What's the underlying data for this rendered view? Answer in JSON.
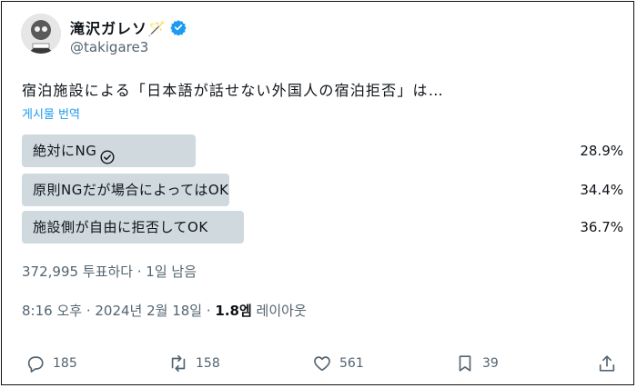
{
  "author": {
    "display_name": "滝沢ガレソ🪄",
    "handle": "@takigare3",
    "verified": true
  },
  "tweet": {
    "text": "宿泊施設による「日本語が話せない外国人の宿泊拒否」は…",
    "translate_label": "게시물 번역"
  },
  "poll": {
    "options": [
      {
        "label": "絶対にNG",
        "percent": "28.9%",
        "value": 28.9,
        "selected": true
      },
      {
        "label": "原則NGだが場合によってはOK",
        "percent": "34.4%",
        "value": 34.4,
        "selected": false
      },
      {
        "label": "施設側が自由に拒否してOK",
        "percent": "36.7%",
        "value": 36.7,
        "selected": false
      }
    ],
    "meta": "372,995 투표하다 · 1일 남음"
  },
  "timestamp": {
    "time": "8:16 오후 · 2024년 2월 18일 · ",
    "views": "1.8엠",
    "views_label": " 레이아웃"
  },
  "actions": {
    "reply_count": "185",
    "retweet_count": "158",
    "like_count": "561",
    "bookmark_count": "39"
  },
  "colors": {
    "poll_bar": "#cfd9de",
    "verified": "#1d9bf0",
    "link": "#1d9bf0",
    "muted": "#536471"
  }
}
